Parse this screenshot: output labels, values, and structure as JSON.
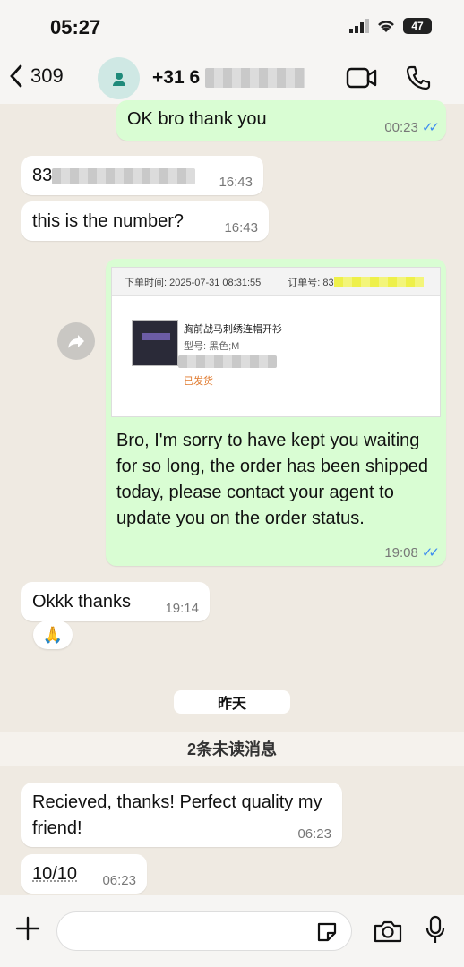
{
  "status_bar": {
    "time": "05:27",
    "battery": "47"
  },
  "header": {
    "back_count": "309",
    "contact_name": "+31 6"
  },
  "messages": [
    {
      "dir": "out",
      "text": "OK bro thank you",
      "time": "00:23"
    },
    {
      "dir": "in",
      "text": "83",
      "time": "16:43"
    },
    {
      "dir": "in",
      "text": "this is the number?",
      "time": "16:43"
    },
    {
      "dir": "out",
      "text": "Bro, I'm sorry to have kept you waiting for so long, the order has been shipped today, please contact your agent to update you on the order status.",
      "time": "19:08"
    },
    {
      "dir": "in",
      "text": "Okkk thanks",
      "time": "19:14"
    },
    {
      "dir": "in",
      "text": "Recieved, thanks! Perfect quality my friend!",
      "time": "06:23"
    },
    {
      "dir": "in",
      "text": "10/10",
      "time": "06:23"
    }
  ],
  "order_card": {
    "order_time": "下单时间: 2025-07-31 08:31:55",
    "order_no_label": "订单号: 83",
    "product_title": "胸前战马刺绣连帽开衫",
    "spec": "型号: 黑色;M",
    "status": "已发货"
  },
  "reaction": {
    "emoji": "🙏"
  },
  "date_divider": "昨天",
  "unread_divider": "2条未读消息",
  "composer": {
    "placeholder": ""
  },
  "colors": {
    "outgoing_bubble": "#d9fdd3",
    "incoming_bubble": "#ffffff",
    "background": "#efeae2",
    "read_ticks": "#3d8cf0"
  }
}
